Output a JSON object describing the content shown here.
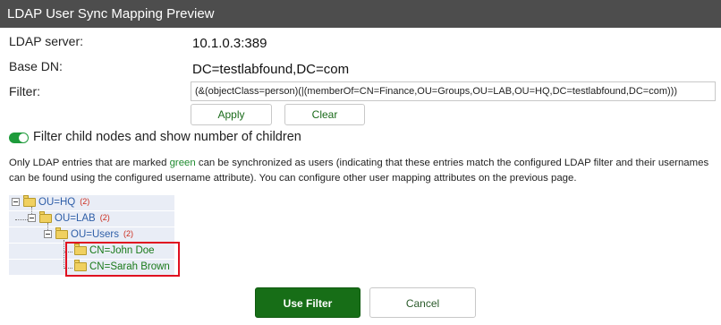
{
  "window": {
    "title": "LDAP User Sync Mapping Preview"
  },
  "fields": {
    "server_label": "LDAP server:",
    "server_value": "10.1.0.3:389",
    "basedn_label": "Base DN:",
    "basedn_value": "DC=testlabfound,DC=com",
    "filter_label": "Filter:",
    "filter_value": "(&(objectClass=person)(|(memberOf=CN=Finance,OU=Groups,OU=LAB,OU=HQ,DC=testlabfound,DC=com)))"
  },
  "buttons": {
    "apply": "Apply",
    "clear": "Clear",
    "use_filter": "Use Filter",
    "cancel": "Cancel"
  },
  "toggle": {
    "label": "Filter child nodes and show number of children",
    "on": true,
    "color": "#1e9b3b"
  },
  "description": {
    "part1": "Only LDAP entries that are marked ",
    "green_word": "green",
    "part2": " can be synchronized as users (indicating that these entries match the configured LDAP filter and their usernames can be found using the configured username attribute). You can configure other user mapping attributes on the previous page."
  },
  "tree": [
    {
      "name": "OU=HQ",
      "count": "(2)"
    },
    {
      "name": "OU=LAB",
      "count": "(2)"
    },
    {
      "name": "OU=Users",
      "count": "(2)"
    },
    {
      "name": "CN=John Doe",
      "count": ""
    },
    {
      "name": "CN=Sarah Brown",
      "count": ""
    }
  ],
  "colors": {
    "titlebar": "#4d4d4d",
    "primary": "#176e17",
    "match_green": "#1a7a1a",
    "highlight": "#e01020"
  }
}
